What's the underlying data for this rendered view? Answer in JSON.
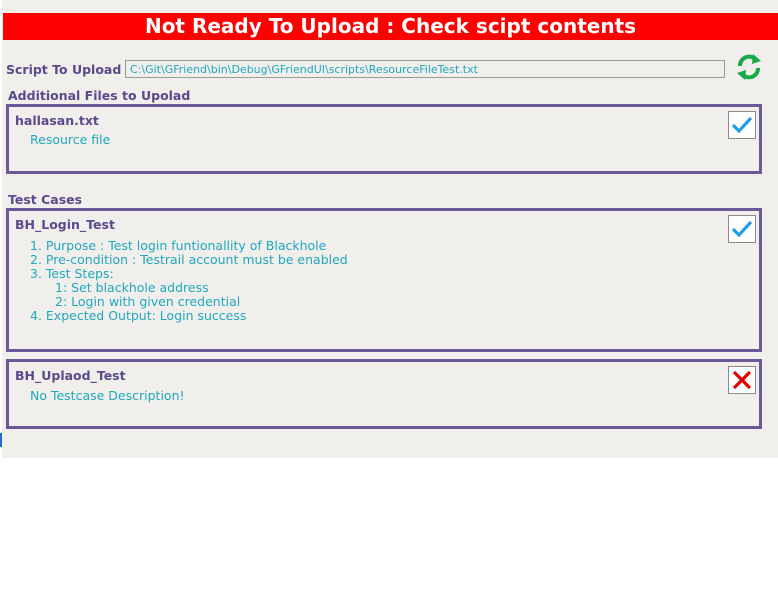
{
  "banner": {
    "text": "Not Ready To Upload : Check scipt contents",
    "color": "#ff0000"
  },
  "script": {
    "label": "Script To Upload",
    "path": "C:\\Git\\GFriend\\bin\\Debug\\GFriendUI\\scripts\\ResourceFileTest.txt",
    "refresh_icon": "refresh-icon"
  },
  "additional_files": {
    "label": "Additional Files to Upolad",
    "items": [
      {
        "name": "hallasan.txt",
        "description": "Resource file",
        "status": "checked"
      }
    ]
  },
  "test_cases": {
    "label": "Test Cases",
    "items": [
      {
        "name": "BH_Login_Test",
        "status": "checked",
        "lines": [
          "1. Purpose : Test login funtionallity of Blackhole",
          "2. Pre-condition : Testrail account must be enabled",
          "3. Test Steps:",
          "1: Set blackhole address",
          "2: Login with given credential",
          "4. Expected Output: Login success"
        ]
      },
      {
        "name": "BH_Uplaod_Test",
        "status": "failed",
        "lines": [
          "No Testcase Description!"
        ]
      }
    ]
  },
  "colors": {
    "accent": "#5a4a8e",
    "text_cyan": "#20a8c0",
    "check_blue": "#1ea0e6",
    "fail_red": "#e00000",
    "border": "#6a5a98"
  }
}
